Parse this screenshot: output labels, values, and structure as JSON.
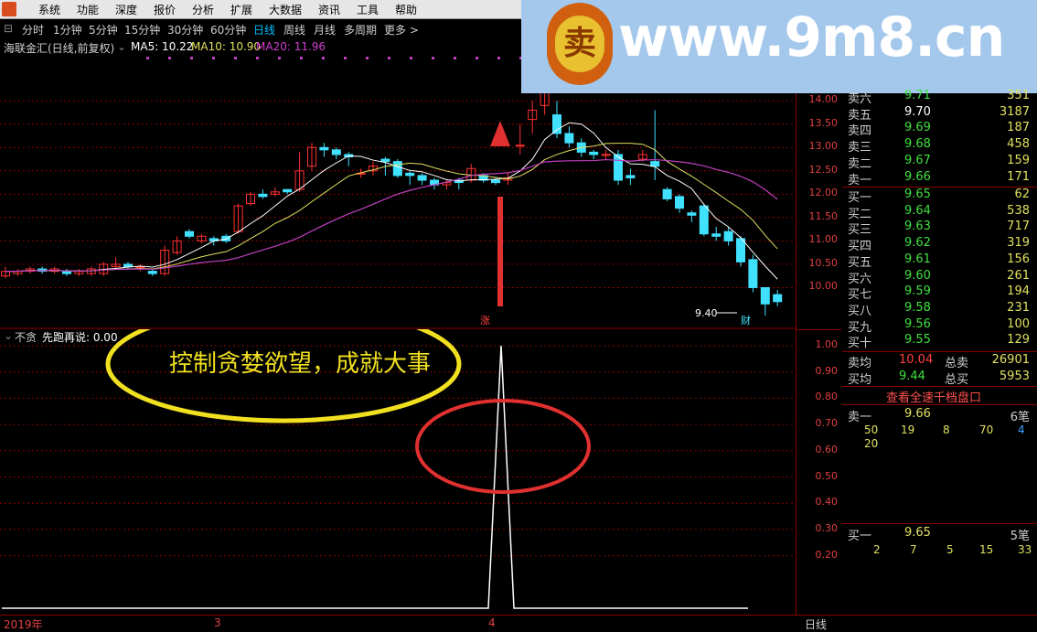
{
  "menubar": {
    "items": [
      "系统",
      "功能",
      "深度",
      "报价",
      "分析",
      "扩展",
      "大数据",
      "资讯",
      "工具",
      "帮助"
    ]
  },
  "periodbar": {
    "items": [
      "分时",
      "1分钟",
      "5分钟",
      "15分钟",
      "30分钟",
      "60分钟",
      "日线",
      "周线",
      "月线",
      "多周期",
      "更多 >"
    ],
    "active": "日线"
  },
  "infobar": {
    "stock_title": "海联金汇(日线,前复权)",
    "ma5": "MA5: 10.22",
    "ma10": "MA10: 10.90",
    "ma20": "MA20: 11.96"
  },
  "main_y_labels": [
    "14.00",
    "13.50",
    "13.00",
    "12.50",
    "12.00",
    "11.50",
    "11.00",
    "10.50",
    "10.00"
  ],
  "sub_y_labels": [
    "1.00",
    "0.90",
    "0.80",
    "0.70",
    "0.60",
    "0.50",
    "0.40",
    "0.30",
    "0.20"
  ],
  "annotation": {
    "low_price": "9.40",
    "rise_tag": "涨",
    "cai_tag": "财"
  },
  "indicator": {
    "name": "不贪",
    "formula_label": "先跑再说: 0.00"
  },
  "slogan": "控制贪婪欲望，成就大事",
  "watermark_text": "www.9m8.cn",
  "watermark_logo": "卖",
  "watermark_small": "www.9m8.cn",
  "bottombar": {
    "year": "2019年",
    "m3": "3",
    "m4": "4",
    "period": "日线"
  },
  "order_book": {
    "sell": [
      {
        "label": "卖六",
        "price": "9.71",
        "vol": "351"
      },
      {
        "label": "卖五",
        "price": "9.70",
        "vol": "3187"
      },
      {
        "label": "卖四",
        "price": "9.69",
        "vol": "187"
      },
      {
        "label": "卖三",
        "price": "9.68",
        "vol": "458"
      },
      {
        "label": "卖二",
        "price": "9.67",
        "vol": "159"
      },
      {
        "label": "卖一",
        "price": "9.66",
        "vol": "171"
      }
    ],
    "buy": [
      {
        "label": "买一",
        "price": "9.65",
        "vol": "62"
      },
      {
        "label": "买二",
        "price": "9.64",
        "vol": "538"
      },
      {
        "label": "买三",
        "price": "9.63",
        "vol": "717"
      },
      {
        "label": "买四",
        "price": "9.62",
        "vol": "319"
      },
      {
        "label": "买五",
        "price": "9.61",
        "vol": "156"
      },
      {
        "label": "买六",
        "price": "9.60",
        "vol": "261"
      },
      {
        "label": "买七",
        "price": "9.59",
        "vol": "194"
      },
      {
        "label": "买八",
        "price": "9.58",
        "vol": "231"
      },
      {
        "label": "买九",
        "price": "9.56",
        "vol": "100"
      },
      {
        "label": "买十",
        "price": "9.55",
        "vol": "129"
      }
    ],
    "avg_sell_label": "卖均",
    "avg_sell": "10.04",
    "total_sell_label": "总卖",
    "total_sell": "26901",
    "avg_buy_label": "买均",
    "avg_buy": "9.44",
    "total_buy_label": "总买",
    "total_buy": "5953",
    "full_book_button": "查看全速千档盘口",
    "sell1_label": "卖一",
    "sell1_price": "9.66",
    "sell1_count": "6笔",
    "sell1_orders": [
      "50",
      "19",
      "8",
      "70",
      "4",
      "20"
    ],
    "buy1_label": "买一",
    "buy1_price": "9.65",
    "buy1_count": "5笔",
    "buy1_orders": [
      "2",
      "7",
      "5",
      "15",
      "33"
    ]
  },
  "colors": {
    "up": "#ff3030",
    "down": "#40e0ff",
    "ma5": "#ffffff",
    "ma10": "#e0e060",
    "ma20": "#c040c0",
    "grid": "#8b0000"
  },
  "chart_data": {
    "type": "candlestick",
    "ylim": [
      9.0,
      14.5
    ],
    "candles": [
      [
        10.25,
        10.35,
        10.45,
        10.2
      ],
      [
        10.3,
        10.35,
        10.4,
        10.25
      ],
      [
        10.35,
        10.4,
        10.45,
        10.3
      ],
      [
        10.4,
        10.35,
        10.45,
        10.3
      ],
      [
        10.35,
        10.4,
        10.45,
        10.3
      ],
      [
        10.35,
        10.3,
        10.4,
        10.25
      ],
      [
        10.3,
        10.35,
        10.4,
        10.25
      ],
      [
        10.3,
        10.4,
        10.45,
        10.25
      ],
      [
        10.3,
        10.5,
        10.55,
        10.25
      ],
      [
        10.45,
        10.5,
        10.65,
        10.4
      ],
      [
        10.5,
        10.45,
        10.55,
        10.4
      ],
      [
        10.45,
        10.45,
        10.5,
        10.35
      ],
      [
        10.35,
        10.3,
        10.4,
        10.25
      ],
      [
        10.3,
        10.8,
        10.9,
        10.25
      ],
      [
        10.75,
        11.0,
        11.1,
        10.7
      ],
      [
        11.2,
        11.1,
        11.25,
        11.05
      ],
      [
        11.0,
        11.1,
        11.15,
        10.95
      ],
      [
        11.05,
        11.0,
        11.1,
        10.9
      ],
      [
        11.1,
        11.0,
        11.15,
        10.95
      ],
      [
        11.2,
        11.75,
        11.8,
        11.15
      ],
      [
        11.8,
        12.0,
        12.05,
        11.75
      ],
      [
        12.0,
        11.95,
        12.1,
        11.9
      ],
      [
        12.0,
        12.05,
        12.15,
        11.95
      ],
      [
        12.1,
        12.05,
        12.1,
        12.0
      ],
      [
        12.1,
        12.5,
        12.9,
        12.05
      ],
      [
        12.6,
        13.0,
        13.1,
        12.5
      ],
      [
        13.0,
        12.95,
        13.1,
        12.8
      ],
      [
        12.95,
        12.85,
        13.0,
        12.75
      ],
      [
        12.85,
        12.8,
        12.9,
        12.6
      ],
      [
        12.45,
        12.45,
        12.55,
        12.35
      ],
      [
        12.5,
        12.6,
        12.7,
        12.4
      ],
      [
        12.75,
        12.7,
        12.8,
        12.4
      ],
      [
        12.7,
        12.4,
        12.75,
        12.35
      ],
      [
        12.45,
        12.4,
        12.5,
        12.2
      ],
      [
        12.4,
        12.3,
        12.45,
        12.2
      ],
      [
        12.3,
        12.2,
        12.35,
        12.1
      ],
      [
        12.2,
        12.25,
        12.3,
        12.1
      ],
      [
        12.3,
        12.25,
        12.35,
        12.1
      ],
      [
        12.3,
        12.55,
        12.65,
        12.25
      ],
      [
        12.4,
        12.3,
        12.45,
        12.25
      ],
      [
        12.3,
        12.25,
        12.35,
        12.2
      ],
      [
        12.3,
        12.35,
        12.45,
        12.2
      ],
      [
        13.05,
        13.05,
        13.5,
        12.85
      ],
      [
        13.6,
        13.8,
        14.0,
        13.3
      ],
      [
        13.9,
        14.4,
        14.5,
        13.7
      ],
      [
        13.7,
        13.3,
        14.0,
        13.2
      ],
      [
        13.3,
        13.1,
        13.45,
        13.0
      ],
      [
        13.1,
        12.9,
        13.2,
        12.8
      ],
      [
        12.9,
        12.85,
        12.95,
        12.75
      ],
      [
        12.85,
        12.85,
        12.95,
        12.75
      ],
      [
        12.85,
        12.3,
        12.95,
        12.2
      ],
      [
        12.4,
        12.35,
        12.55,
        12.2
      ],
      [
        12.75,
        12.85,
        12.95,
        12.7
      ],
      [
        12.7,
        12.6,
        13.8,
        12.3
      ],
      [
        12.1,
        11.9,
        12.15,
        11.85
      ],
      [
        11.95,
        11.7,
        12.0,
        11.6
      ],
      [
        11.6,
        11.55,
        11.65,
        11.4
      ],
      [
        11.75,
        11.15,
        11.8,
        11.1
      ],
      [
        11.15,
        11.1,
        11.3,
        11.0
      ],
      [
        11.2,
        11.0,
        11.3,
        10.9
      ],
      [
        11.05,
        10.55,
        11.1,
        10.45
      ],
      [
        10.6,
        10.0,
        10.7,
        9.9
      ],
      [
        10.0,
        9.65,
        10.0,
        9.4
      ],
      [
        9.85,
        9.7,
        9.95,
        9.6
      ]
    ],
    "indicator_series_name": "先跑再说",
    "indicator_peak_value": 1.0,
    "indicator_ylim": [
      0,
      1.05
    ]
  }
}
